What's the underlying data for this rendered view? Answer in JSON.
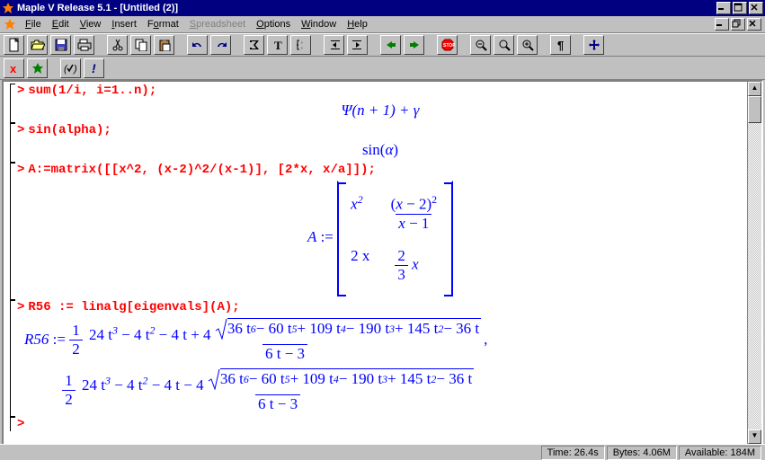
{
  "title": "Maple V Release 5.1 - [Untitled (2)]",
  "menu": {
    "file": "File",
    "edit": "Edit",
    "view": "View",
    "insert": "Insert",
    "format": "Format",
    "spreadsheet": "Spreadsheet",
    "options": "Options",
    "window": "Window",
    "help": "Help"
  },
  "tool": {
    "new_icon": "new-file-icon",
    "open_icon": "open-folder-icon",
    "save_icon": "save-disk-icon",
    "print_icon": "printer-icon",
    "cut_icon": "scissors-icon",
    "copy_icon": "copy-icon",
    "paste_icon": "clipboard-icon",
    "undo_icon": "undo-icon",
    "redo_icon": "redo-icon",
    "sigma_icon": "sigma-icon",
    "text_icon": "text-T-icon",
    "indent_l": "outdent-icon",
    "indent_r": "indent-icon",
    "back_icon": "arrow-left-icon",
    "fwd_icon": "arrow-right-icon",
    "stop_icon": "stop-icon",
    "zoomout_icon": "zoom-out-icon",
    "zoom100_icon": "zoom-reset-icon",
    "zoomin_icon": "zoom-in-icon",
    "pilcrow_icon": "pilcrow-icon",
    "resize_icon": "resize-icon",
    "x_icon": "red-x-icon",
    "leaf_icon": "maple-leaf-icon",
    "check_icon": "check-paren-icon",
    "exec_icon": "execute-bang-icon"
  },
  "ws": {
    "p": ">",
    "in1": "sum(1/i, i=1..n);",
    "out1": "Ψ(n + 1) + γ",
    "in2": "sin(alpha);",
    "out2_a": "sin(",
    "out2_b": "α",
    "out2_c": ")",
    "in3": "A:=matrix([[x^2, (x-2)^2/(x-1)], [2*x, x/a]]);",
    "out3_lhs": "A",
    "out3_assign": " := ",
    "out3_m11": "x",
    "out3_m11e": "2",
    "out3_m12n_a": "(",
    "out3_m12n_b": "x",
    "out3_m12n_c": " − 2)",
    "out3_m12n_e": "2",
    "out3_m12d_a": "x",
    "out3_m12d_b": " − 1",
    "out3_m21": "2 x",
    "out3_m22na": "2",
    "out3_m22nb": "3",
    "out3_m22c": " x",
    "in4": "R56 := linalg[eigenvals](A);",
    "out4_lhs": "R56",
    "out4_assign": " := ",
    "half_n": "1",
    "half_d": "2",
    "poly_pre": "24 t",
    "e3": "3",
    "poly_a": " − 4 t",
    "e2": "2",
    "poly_b": " − 4 t + 4 ",
    "poly_b2": " − 4 t − 4 ",
    "rad_a": "36 t",
    "e6": "6",
    "rad_b": " − 60 t",
    "e5": "5",
    "rad_c": " + 109 t",
    "e4": "4",
    "rad_d": " − 190 t",
    "rad_e": " + 145 t",
    "rad_f": " − 36 t",
    "den": "6 t − 3",
    "comma": ","
  },
  "status": {
    "time": "Time: 26.4s",
    "bytes": "Bytes: 4.06M",
    "avail": "Available: 184M"
  }
}
